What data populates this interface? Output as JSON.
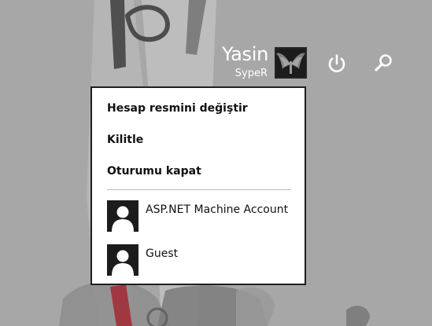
{
  "user": {
    "name": "Yasin",
    "username": "SypeR"
  },
  "top_icons": {
    "power_icon": "power-icon",
    "search_icon": "search-icon",
    "user_tile_icon": "winged-avatar-icon"
  },
  "menu": {
    "items": [
      {
        "label": "Hesap resmini değiştir"
      },
      {
        "label": "Kilitle"
      },
      {
        "label": "Oturumu kapat"
      }
    ],
    "accounts": [
      {
        "label": "ASP.NET Machine Account",
        "icon": "user-silhouette-icon"
      },
      {
        "label": "Guest",
        "icon": "user-silhouette-icon"
      }
    ]
  },
  "colors": {
    "background": "#a7a7a7",
    "menu_background": "#ffffff",
    "menu_border": "#1f1f1f",
    "avatar_background": "#1c1c1c",
    "text_light": "#ffffff",
    "text_dark": "#111111"
  }
}
